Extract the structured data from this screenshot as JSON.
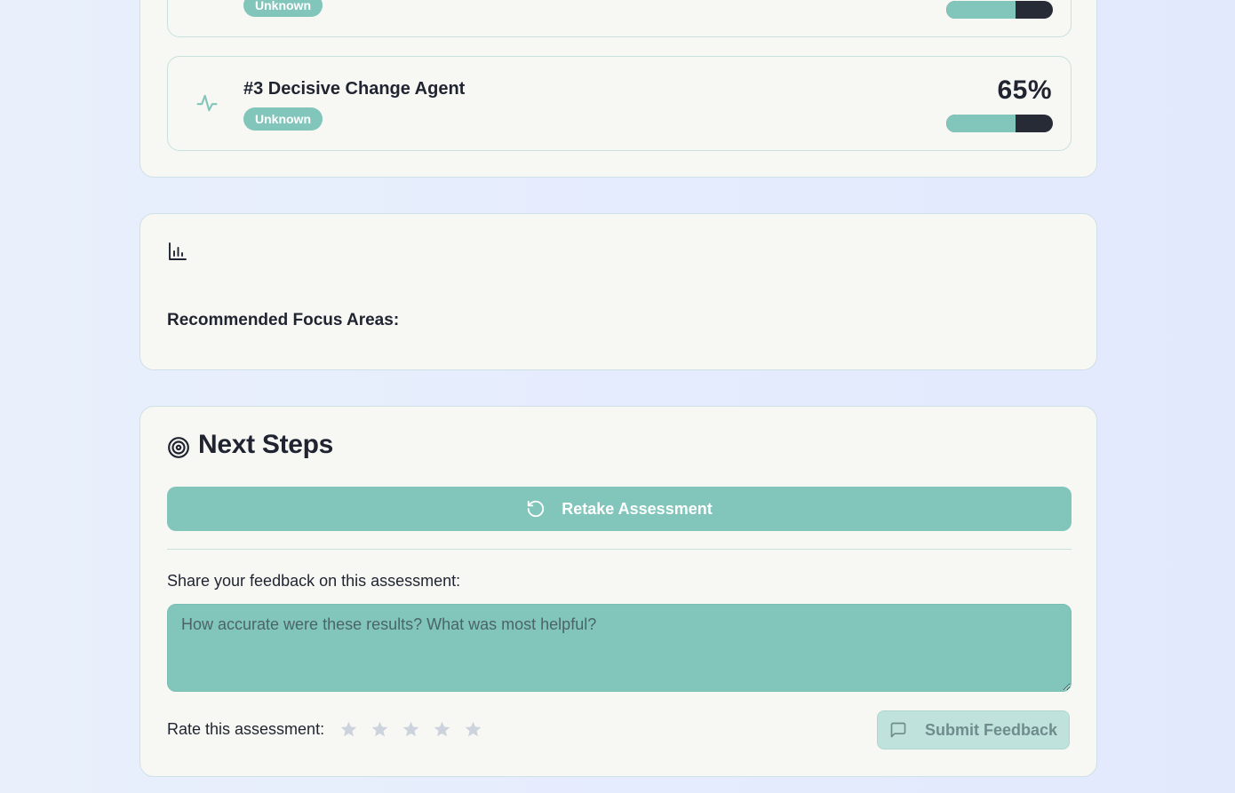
{
  "archetypes": [
    {
      "label": "",
      "badge": "Unknown",
      "percent_text": "",
      "percent": 65,
      "icon": "activity-icon"
    },
    {
      "label": "#3 Decisive Change Agent",
      "badge": "Unknown",
      "percent_text": "65%",
      "percent": 65,
      "icon": "activity-icon"
    }
  ],
  "focus": {
    "icon": "bar-chart-icon",
    "label": "Recommended Focus Areas:"
  },
  "next_steps": {
    "icon": "target-icon",
    "title": "Next Steps",
    "retake_label": "Retake Assessment",
    "retake_icon": "rotate-ccw-icon",
    "feedback_label": "Share your feedback on this assessment:",
    "feedback_placeholder": "How accurate were these results? What was most helpful?",
    "feedback_value": "",
    "rate_label": "Rate this assessment:",
    "rating": 0,
    "max_rating": 5,
    "submit_label": "Submit Feedback",
    "submit_icon": "message-square-icon"
  },
  "colors": {
    "accent": "#82c5bb",
    "bar_track": "#262b36",
    "card_bg": "#f7f7f4",
    "star_inactive": "#cdd3dc",
    "submit_disabled_bg": "#bfe2dc"
  }
}
